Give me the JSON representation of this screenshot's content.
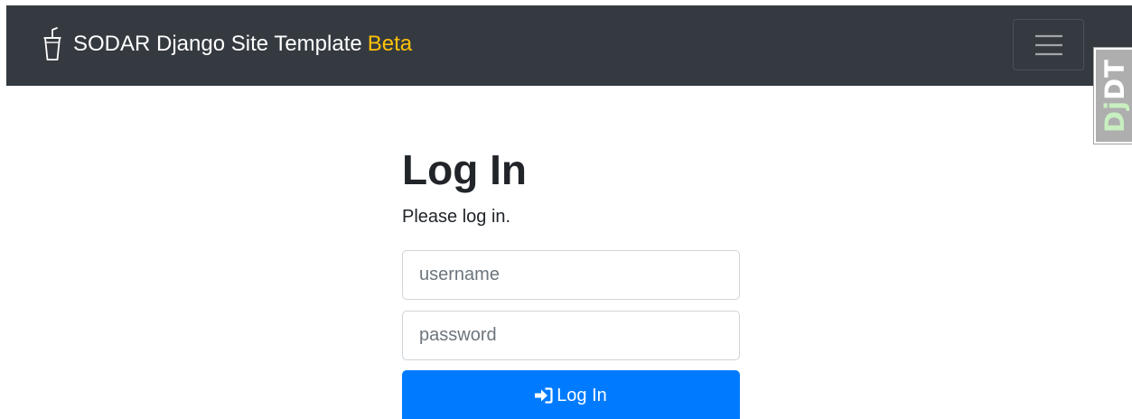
{
  "navbar": {
    "brand_icon": "cup-with-straw-icon",
    "brand_name": "SODAR Django Site Template",
    "brand_badge": "Beta",
    "badge_color": "#ffc107",
    "background_color": "#343a40",
    "menu_icon": "hamburger-menu-icon"
  },
  "debug_toolbar": {
    "label_dj": "Dj",
    "label_dt": "DT"
  },
  "login": {
    "title": "Log In",
    "subtitle": "Please log in.",
    "username": {
      "value": "",
      "placeholder": "username"
    },
    "password": {
      "value": "",
      "placeholder": "password"
    },
    "submit_icon": "sign-in-icon",
    "submit_label": "Log In",
    "submit_color": "#007bff"
  }
}
